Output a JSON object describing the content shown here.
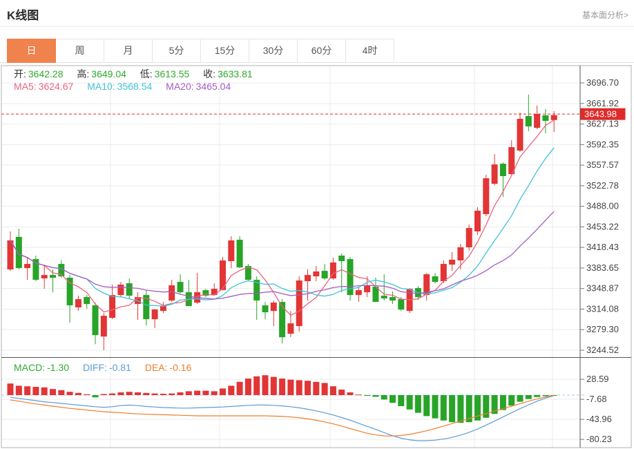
{
  "header": {
    "title": "K线图",
    "link_fundamental": "基本面分析>"
  },
  "tabs": {
    "items": [
      "日",
      "周",
      "月",
      "5分",
      "15分",
      "30分",
      "60分",
      "4时"
    ],
    "active": "日"
  },
  "info_bar": {
    "ohlc": [
      {
        "label": "开:",
        "value": "3642.28"
      },
      {
        "label": "高:",
        "value": "3649.04"
      },
      {
        "label": "低:",
        "value": "3613.55"
      },
      {
        "label": "收:",
        "value": "3633.81"
      }
    ],
    "ma": [
      {
        "label": "MA5:",
        "value": "3624.67"
      },
      {
        "label": "MA10:",
        "value": "3568.54"
      },
      {
        "label": "MA20:",
        "value": "3465.04"
      }
    ]
  },
  "macd_bar": {
    "items": [
      {
        "label": "MACD:",
        "value": "-1.30"
      },
      {
        "label": "DIFF:",
        "value": "-0.81"
      },
      {
        "label": "DEA:",
        "value": "-0.16"
      }
    ]
  },
  "chart_data": {
    "type": "candlestick",
    "title": "K线图",
    "panels": [
      "price",
      "macd"
    ],
    "legend": [
      "MA5",
      "MA10",
      "MA20",
      "DIFF",
      "DEA",
      "MACD"
    ],
    "price_axis": {
      "tick_labels": [
        "3696.70",
        "3661.92",
        "3627.13",
        "3592.35",
        "3557.57",
        "3522.78",
        "3488.00",
        "3453.22",
        "3418.43",
        "3383.65",
        "3348.87",
        "3314.08",
        "3279.30",
        "3244.52"
      ],
      "current_price": "3643.98",
      "range": [
        3230,
        3735
      ]
    },
    "macd_axis": {
      "tick_labels": [
        "28.59",
        "-7.68",
        "-43.96",
        "-80.23"
      ],
      "range": [
        -90,
        40
      ]
    },
    "colors": {
      "up": "#e23535",
      "down": "#28a428",
      "ma5": "#e9637e",
      "ma10": "#3fc3d8",
      "ma20": "#a55bc1",
      "diff": "#5b9bd5",
      "dea": "#f07d28",
      "current_line": "#e02a2a",
      "active_tab": "#f0824d",
      "ohlc_value": "#2eaa2e"
    },
    "candles": [
      [
        3381.2,
        3445.5,
        3378.8,
        3430.3,
        "r"
      ],
      [
        3436.2,
        3450.2,
        3381.2,
        3383.5,
        "g"
      ],
      [
        3383.5,
        3402.2,
        3363.6,
        3390.5,
        "r"
      ],
      [
        3398.7,
        3404.6,
        3361.3,
        3363.6,
        "g"
      ],
      [
        3366.0,
        3389.4,
        3348.4,
        3371.8,
        "r"
      ],
      [
        3371.8,
        3381.2,
        3342.6,
        3367.2,
        "g"
      ],
      [
        3390.5,
        3396.4,
        3367.2,
        3369.5,
        "g"
      ],
      [
        3367.2,
        3371.8,
        3291.1,
        3320.4,
        "g"
      ],
      [
        3316.9,
        3336.8,
        3311.0,
        3330.9,
        "r"
      ],
      [
        3334.4,
        3337.9,
        3314.5,
        3322.7,
        "g"
      ],
      [
        3320.4,
        3325.1,
        3254.8,
        3270.1,
        "g"
      ],
      [
        3267.7,
        3307.5,
        3244.5,
        3302.8,
        "r"
      ],
      [
        3299.3,
        3355.5,
        3297.0,
        3337.9,
        "r"
      ],
      [
        3337.9,
        3360.1,
        3334.4,
        3355.5,
        "r"
      ],
      [
        3357.8,
        3366.0,
        3330.9,
        3336.8,
        "g"
      ],
      [
        3322.7,
        3342.6,
        3295.8,
        3334.4,
        "r"
      ],
      [
        3337.9,
        3346.1,
        3286.4,
        3297.0,
        "g"
      ],
      [
        3297.0,
        3314.5,
        3281.8,
        3313.4,
        "r"
      ],
      [
        3311.0,
        3326.2,
        3307.5,
        3319.2,
        "r"
      ],
      [
        3328.6,
        3363.6,
        3326.2,
        3354.3,
        "r"
      ],
      [
        3360.1,
        3373.0,
        3340.3,
        3342.6,
        "g"
      ],
      [
        3342.6,
        3363.6,
        3319.2,
        3319.2,
        "g"
      ],
      [
        3325.1,
        3375.3,
        3322.7,
        3342.6,
        "r"
      ],
      [
        3346.1,
        3348.4,
        3334.4,
        3336.8,
        "g"
      ],
      [
        3337.9,
        3357.8,
        3336.8,
        3348.4,
        "r"
      ],
      [
        3346.1,
        3402.2,
        3346.1,
        3396.4,
        "r"
      ],
      [
        3395.2,
        3437.3,
        3383.5,
        3430.3,
        "r"
      ],
      [
        3431.4,
        3437.3,
        3383.5,
        3384.7,
        "g"
      ],
      [
        3387.0,
        3390.5,
        3361.3,
        3363.6,
        "g"
      ],
      [
        3363.6,
        3369.5,
        3295.8,
        3328.6,
        "g"
      ],
      [
        3320.4,
        3326.2,
        3297.0,
        3308.7,
        "g"
      ],
      [
        3311.0,
        3328.6,
        3285.3,
        3325.1,
        "r"
      ],
      [
        3326.2,
        3330.9,
        3256.0,
        3266.5,
        "g"
      ],
      [
        3272.4,
        3311.0,
        3266.5,
        3290.0,
        "r"
      ],
      [
        3285.3,
        3369.5,
        3275.9,
        3362.5,
        "r"
      ],
      [
        3361.3,
        3381.2,
        3328.6,
        3371.8,
        "r"
      ],
      [
        3369.5,
        3387.0,
        3361.3,
        3377.7,
        "r"
      ],
      [
        3378.8,
        3390.5,
        3363.6,
        3366.0,
        "g"
      ],
      [
        3366.0,
        3401.1,
        3363.6,
        3392.9,
        "r"
      ],
      [
        3404.6,
        3408.1,
        3342.6,
        3395.2,
        "g"
      ],
      [
        3398.7,
        3402.2,
        3328.6,
        3337.9,
        "g"
      ],
      [
        3337.9,
        3352.0,
        3326.2,
        3346.1,
        "r"
      ],
      [
        3342.6,
        3369.5,
        3334.4,
        3354.3,
        "r"
      ],
      [
        3352.0,
        3367.2,
        3326.2,
        3326.2,
        "g"
      ],
      [
        3336.8,
        3373.0,
        3328.6,
        3332.1,
        "g"
      ],
      [
        3334.4,
        3343.8,
        3322.7,
        3328.6,
        "g"
      ],
      [
        3330.9,
        3334.4,
        3311.0,
        3313.4,
        "g"
      ],
      [
        3311.0,
        3349.6,
        3307.5,
        3348.4,
        "r"
      ],
      [
        3349.6,
        3353.2,
        3329.8,
        3334.4,
        "g"
      ],
      [
        3337.9,
        3375.3,
        3328.6,
        3373.0,
        "r"
      ],
      [
        3369.5,
        3375.3,
        3357.8,
        3360.1,
        "g"
      ],
      [
        3361.3,
        3396.4,
        3357.8,
        3390.5,
        "r"
      ],
      [
        3389.4,
        3410.4,
        3378.8,
        3397.6,
        "r"
      ],
      [
        3396.4,
        3424.5,
        3381.2,
        3418.6,
        "r"
      ],
      [
        3418.6,
        3457.2,
        3412.8,
        3451.3,
        "r"
      ],
      [
        3445.5,
        3486.4,
        3439.6,
        3480.5,
        "r"
      ],
      [
        3474.7,
        3541.3,
        3471.2,
        3535.4,
        "r"
      ],
      [
        3526.1,
        3576.3,
        3523.7,
        3558.8,
        "r"
      ],
      [
        3560.0,
        3562.3,
        3503.9,
        3539.0,
        "g"
      ],
      [
        3542.4,
        3599.7,
        3541.3,
        3588.0,
        "r"
      ],
      [
        3582.2,
        3646.5,
        3579.8,
        3636.0,
        "r"
      ],
      [
        3640.7,
        3676.9,
        3614.9,
        3623.1,
        "g"
      ],
      [
        3620.8,
        3658.2,
        3618.4,
        3644.2,
        "r"
      ],
      [
        3641.8,
        3652.4,
        3611.4,
        3632.5,
        "g"
      ],
      [
        3642.28,
        3649.04,
        3613.55,
        3633.81,
        "r"
      ]
    ],
    "macd": {
      "hist": [
        21,
        17,
        16,
        15,
        14,
        11,
        9,
        6,
        4,
        1.5,
        -4,
        2,
        3,
        5,
        6,
        5,
        4,
        3,
        2.5,
        3,
        5,
        7,
        8,
        8,
        7,
        12,
        17,
        24,
        30,
        34,
        36,
        33,
        30,
        28,
        27,
        26,
        24,
        22,
        16,
        10,
        5,
        1,
        -0.5,
        -3,
        -8,
        -14,
        -20,
        -26,
        -32,
        -38,
        -42,
        -46,
        -49,
        -50,
        -49,
        -46,
        -41,
        -34,
        -27,
        -19,
        -12,
        -7,
        -3.5,
        -1.8,
        -1.3
      ],
      "diff": [
        -3.8,
        -6,
        -8,
        -10,
        -12,
        -13.5,
        -15,
        -16.5,
        -18,
        -19.5,
        -21,
        -22,
        -21,
        -19,
        -18,
        -19,
        -20.5,
        -21.5,
        -22.5,
        -23,
        -23.5,
        -23.5,
        -23,
        -22.5,
        -22,
        -21.5,
        -20.5,
        -19.5,
        -18.5,
        -18,
        -18,
        -18.5,
        -19.5,
        -21,
        -23,
        -25.5,
        -28.5,
        -32,
        -36,
        -40.5,
        -45.5,
        -51,
        -56.5,
        -62,
        -68,
        -73.5,
        -78,
        -81,
        -82.5,
        -82.5,
        -81.5,
        -79.5,
        -76.5,
        -72.5,
        -67.5,
        -61.5,
        -54.5,
        -47,
        -39.5,
        -32,
        -24.5,
        -17.5,
        -11,
        -5.5,
        -0.81
      ],
      "dea": [
        -8.8,
        -11,
        -13.5,
        -16,
        -18,
        -20,
        -22,
        -24,
        -25.5,
        -27,
        -28.5,
        -30,
        -31,
        -32,
        -33,
        -34,
        -34.5,
        -35,
        -35.5,
        -36,
        -36.5,
        -37,
        -37.5,
        -37.5,
        -37.5,
        -37.5,
        -37.5,
        -37.5,
        -37.5,
        -37.5,
        -37.5,
        -38,
        -38.5,
        -39.5,
        -41,
        -43,
        -45.5,
        -48.5,
        -52,
        -56,
        -60.5,
        -65,
        -69,
        -72,
        -73.8,
        -74,
        -73,
        -71,
        -68,
        -64.5,
        -60.5,
        -56,
        -51.5,
        -47,
        -42.5,
        -38,
        -33.5,
        -29,
        -24.5,
        -20,
        -15.5,
        -11,
        -7,
        -3.3,
        -0.16
      ]
    }
  }
}
